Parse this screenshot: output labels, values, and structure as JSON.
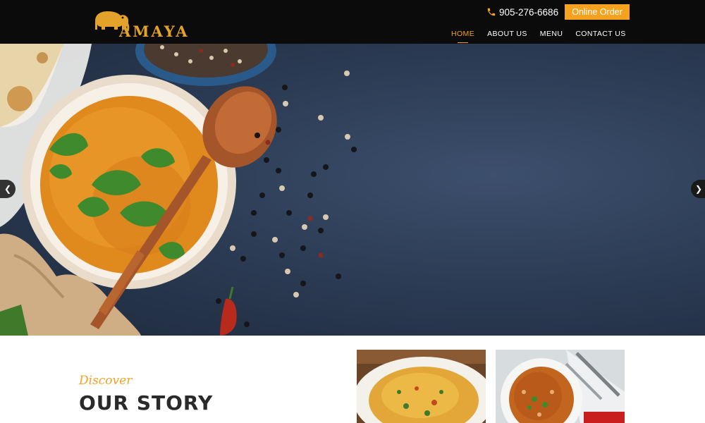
{
  "header": {
    "logo_text": "AMAYA",
    "phone": "905-276-6686",
    "order_button": "Online Order",
    "nav": [
      {
        "label": "HOME",
        "active": true
      },
      {
        "label": "ABOUT US",
        "active": false
      },
      {
        "label": "MENU",
        "active": false
      },
      {
        "label": "CONTACT US",
        "active": false
      }
    ]
  },
  "story": {
    "kicker": "Discover",
    "title": "OUR STORY"
  },
  "colors": {
    "accent": "#f5a21e",
    "header_bg": "#0b0b0b",
    "hero_bg": "#2d3d56"
  },
  "icons": {
    "logo": "elephant-icon",
    "phone": "phone-icon",
    "prev": "chevron-left-icon",
    "next": "chevron-right-icon"
  }
}
